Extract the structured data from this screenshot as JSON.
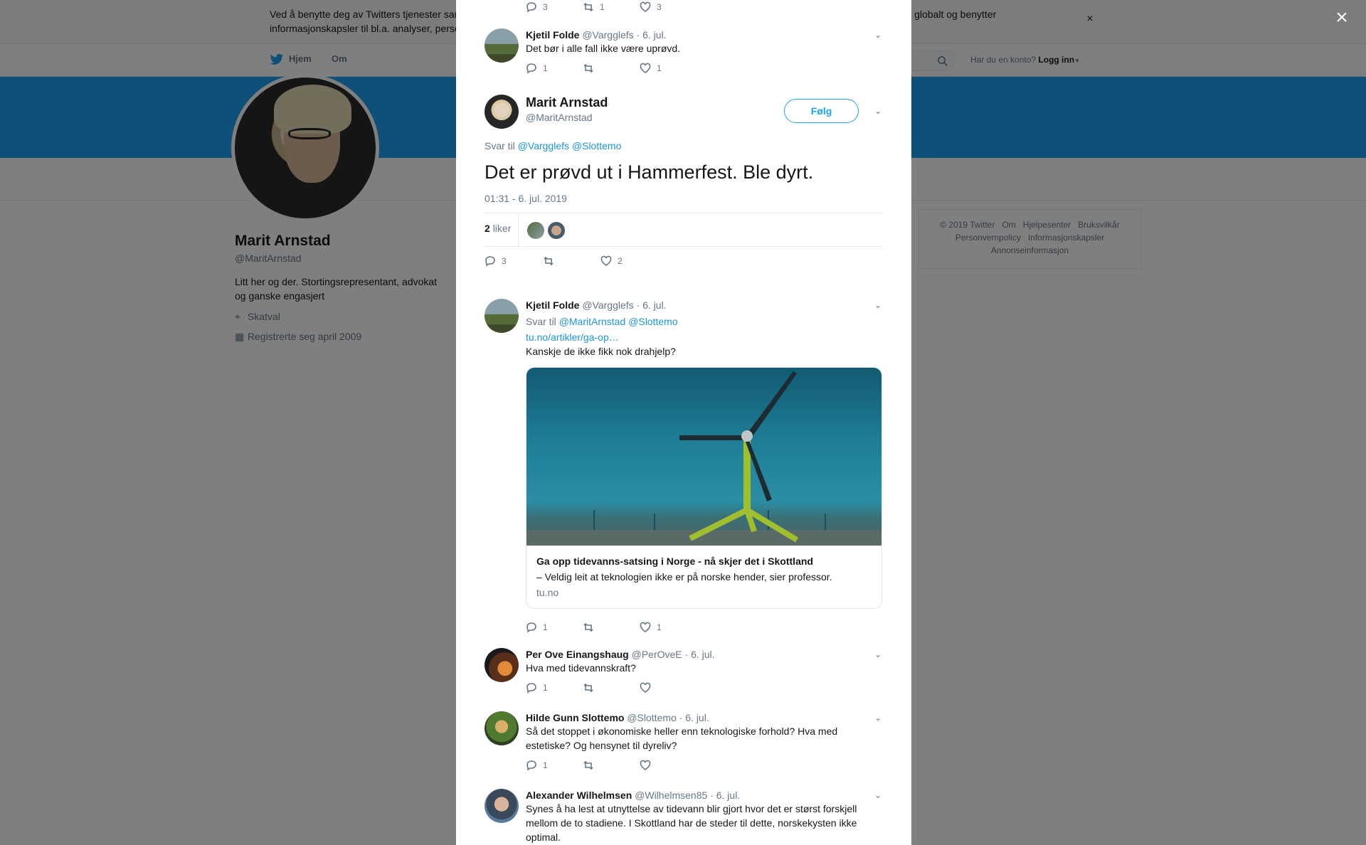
{
  "cookie": {
    "text": "Ved å benytte deg av Twitters tjenester samtykker du til vår bruk av informasjonskapsler og datadeling med partnere. Vi og våre partnere opererer globalt og benytter informasjonskapsler til bl.a. analyser, personalisering og annonser.",
    "close": "×"
  },
  "nav": {
    "home": "Hjem",
    "about": "Om",
    "login_prompt": "Har du en konto?",
    "login": "Logg inn"
  },
  "profile": {
    "name": "Marit Arnstad",
    "handle": "@MaritArnstad",
    "bio": "Litt her og der. Stortingsrepresentant, advokat og ganske engasjert",
    "location": "Skatval",
    "joined": "Registrerte seg april 2009"
  },
  "footer": {
    "links": [
      "© 2019 Twitter",
      "Om",
      "Hjelpesenter",
      "Bruksvilkår",
      "Personvernpolicy",
      "Informasjonskapsler",
      "Annonseinformasjon"
    ]
  },
  "modal_close": "×",
  "top_actions": {
    "replies": "3",
    "retweets": "1",
    "likes": "3"
  },
  "tweet_prev": {
    "name": "Kjetil Folde",
    "handle": "@Vargglefs",
    "date": "· 6. jul.",
    "text": "Det bør i alle fall ikke være uprøvd.",
    "replies": "1",
    "likes": "1"
  },
  "main_tweet": {
    "name": "Marit Arnstad",
    "handle": "@MaritArnstad",
    "follow": "Følg",
    "reply_to_label": "Svar til",
    "reply_to": "@Vargglefs @Slottemo",
    "text": "Det er prøvd ut i Hammerfest. Ble dyrt.",
    "timestamp": "01:31 - 6. jul. 2019",
    "likes_count": "2",
    "likes_label": "liker",
    "replies": "3",
    "likes": "2"
  },
  "replies": [
    {
      "name": "Kjetil Folde",
      "handle": "@Vargglefs",
      "date": "· 6. jul.",
      "reply_to_label": "Svar til",
      "reply_to": "@MaritArnstad @Slottemo",
      "link": "tu.no/artikler/ga-op…",
      "text": "Kanskje de ikke fikk nok drahjelp?",
      "card": {
        "title": "Ga opp tidevanns-satsing i Norge - nå skjer det i Skottland",
        "desc": "– Veldig leit at teknologien ikke er på norske hender, sier professor.",
        "domain": "tu.no"
      },
      "replies": "1",
      "likes": "1"
    },
    {
      "name": "Per Ove Einangshaug",
      "handle": "@PerOveE",
      "date": "· 6. jul.",
      "text": "Hva med tidevannskraft?",
      "replies": "1",
      "likes": ""
    },
    {
      "name": "Hilde Gunn Slottemo",
      "handle": "@Slottemo",
      "date": "· 6. jul.",
      "text": "Så det stoppet i økonomiske heller enn teknologiske forhold? Hva med estetiske? Og hensynet til dyreliv?",
      "replies": "1",
      "likes": ""
    },
    {
      "name": "Alexander Wilhelmsen",
      "handle": "@Wilhelmsen85",
      "date": "· 6. jul.",
      "text": "Synes å ha lest at utnyttelse av tidevann blir gjort hvor det er størst forskjell mellom de to stadiene. I Skottland har de steder til dette, norskekysten ikke optimal."
    }
  ]
}
